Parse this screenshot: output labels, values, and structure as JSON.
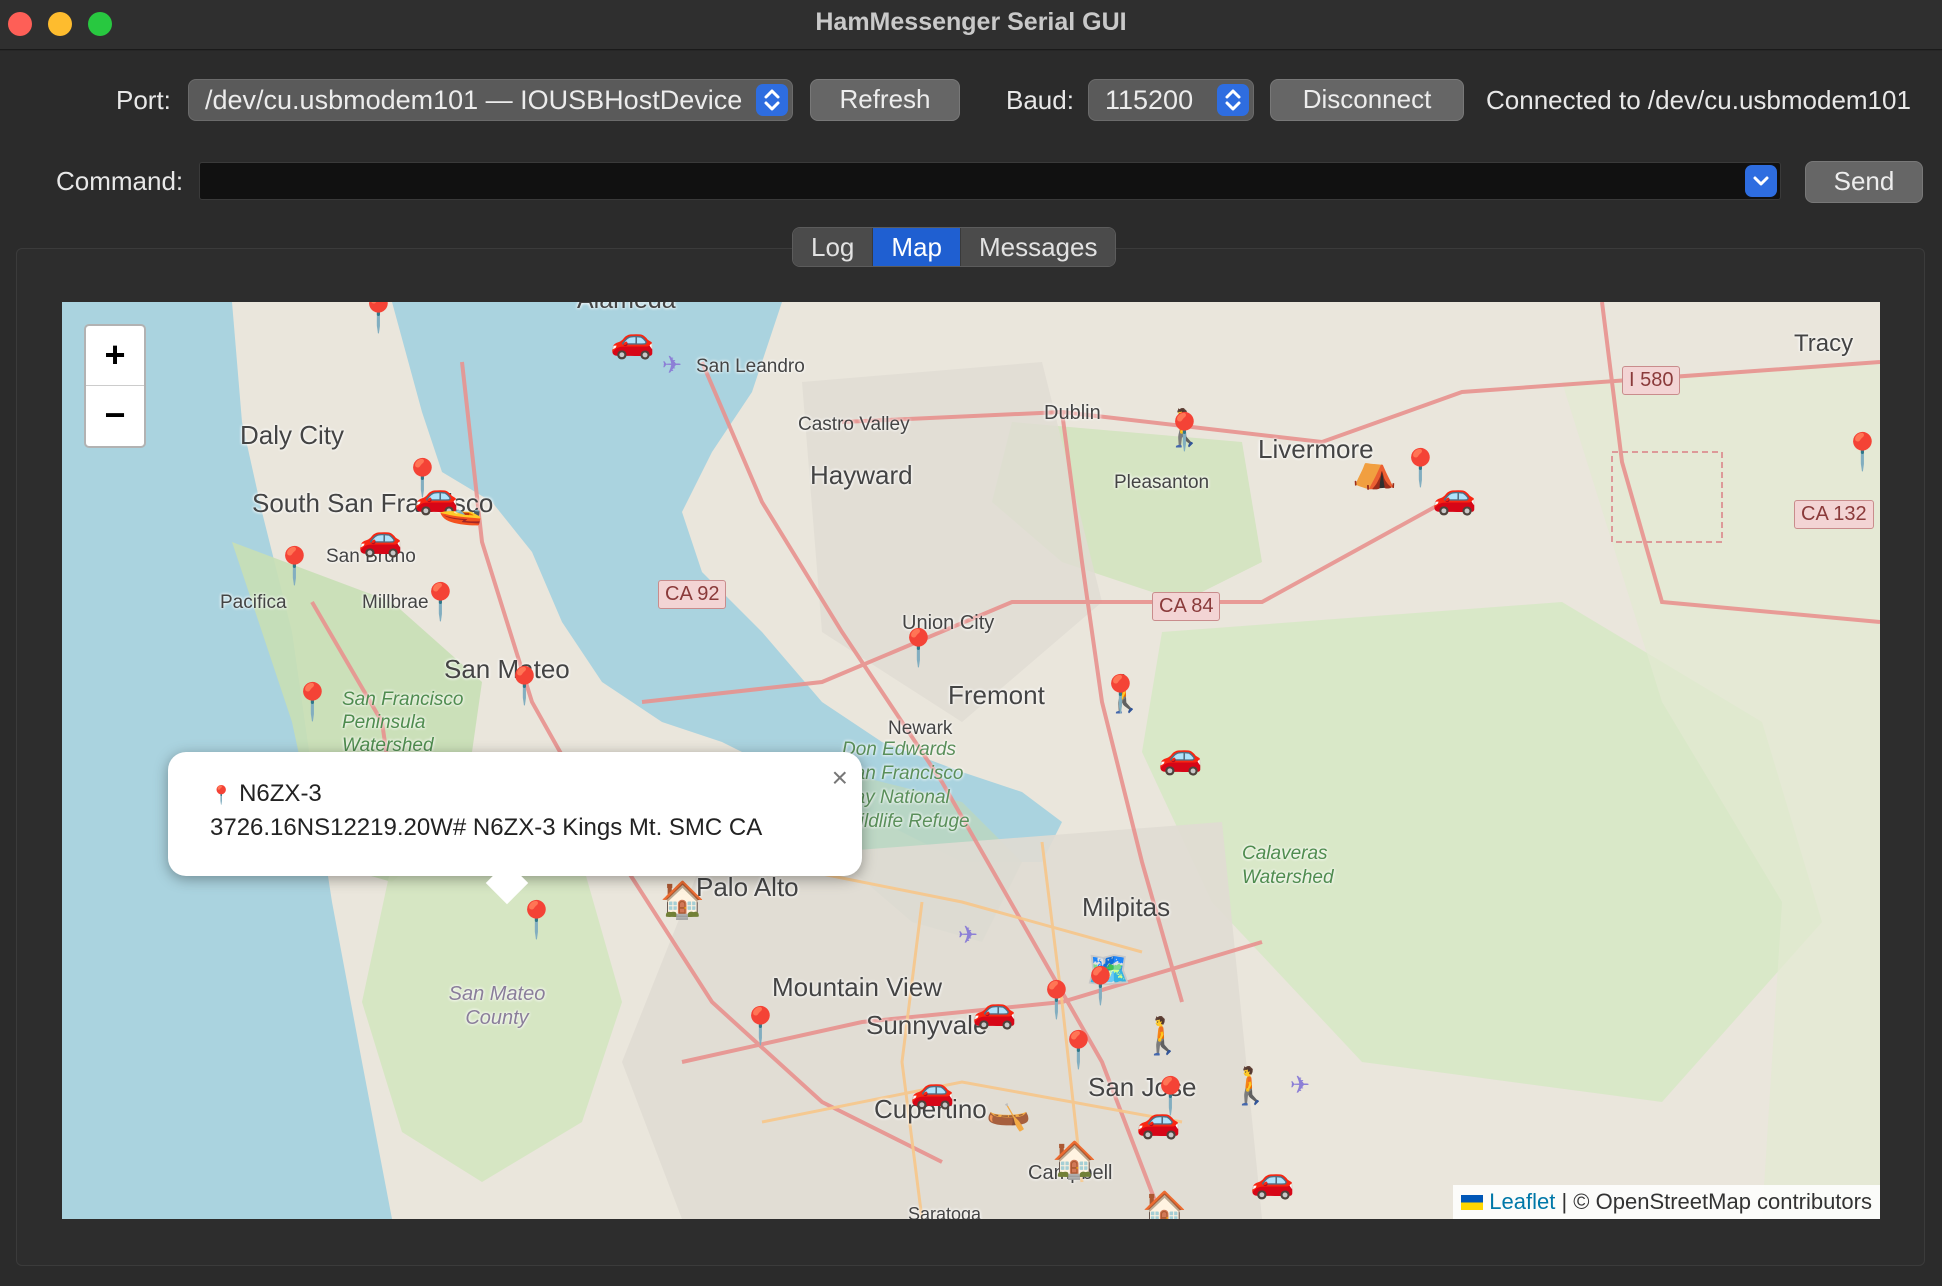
{
  "window": {
    "title": "HamMessenger Serial GUI"
  },
  "toolbar": {
    "port_label": "Port:",
    "port_value": "/dev/cu.usbmodem101 — IOUSBHostDevice",
    "refresh_label": "Refresh",
    "baud_label": "Baud:",
    "baud_value": "115200",
    "disconnect_label": "Disconnect",
    "status": "Connected to /dev/cu.usbmodem101"
  },
  "command": {
    "label": "Command:",
    "value": "",
    "send_label": "Send"
  },
  "tabs": [
    {
      "label": "Log",
      "active": false
    },
    {
      "label": "Map",
      "active": true
    },
    {
      "label": "Messages",
      "active": false
    }
  ],
  "map": {
    "zoom_in": "+",
    "zoom_out": "−",
    "places": {
      "alameda": "Alameda",
      "san_leandro": "San Leandro",
      "daly_city": "Daly City",
      "castro_valley": "Castro Valley",
      "dublin": "Dublin",
      "hayward": "Hayward",
      "livermore": "Livermore",
      "pleasanton": "Pleasanton",
      "tracy": "Tracy",
      "south_sf": "South San Francisco",
      "san_bruno": "San Bruno",
      "pacifica": "Pacifica",
      "millbrae": "Millbrae",
      "union_city": "Union City",
      "san_mateo": "San Mateo",
      "fremont": "Fremont",
      "newark": "Newark",
      "sf_peninsula_watershed": "San Francisco Peninsula Watershed",
      "don_edwards": "Don Edwards San Francisco Bay National Wildlife Refuge",
      "calaveras": "Calaveras Watershed",
      "palo_alto": "Palo Alto",
      "milpitas": "Milpitas",
      "mountain_view": "Mountain View",
      "sunnyvale": "Sunnyvale",
      "san_mateo_county": "San Mateo County",
      "san_jose": "San Jose",
      "cupertino": "Cupertino",
      "campbell": "Campbell",
      "saratoga": "Saratoga"
    },
    "shields": {
      "ca92": "CA 92",
      "ca84": "CA 84",
      "i580": "I 580",
      "ca132": "CA 132"
    },
    "markers": {
      "pin": "📍",
      "car": "🚗",
      "boat": "🚤",
      "walker": "🚶",
      "tent": "⛺",
      "house": "🏠",
      "canoe": "🛶",
      "mapicon": "🗺️",
      "plane": "✈"
    },
    "popup": {
      "close": "×",
      "icon": "📍",
      "title": "N6ZX-3",
      "body": "3726.16NS12219.20W# N6ZX-3 Kings Mt. SMC CA"
    },
    "attribution": {
      "leaflet": "Leaflet",
      "rest": " | © OpenStreetMap contributors"
    }
  }
}
